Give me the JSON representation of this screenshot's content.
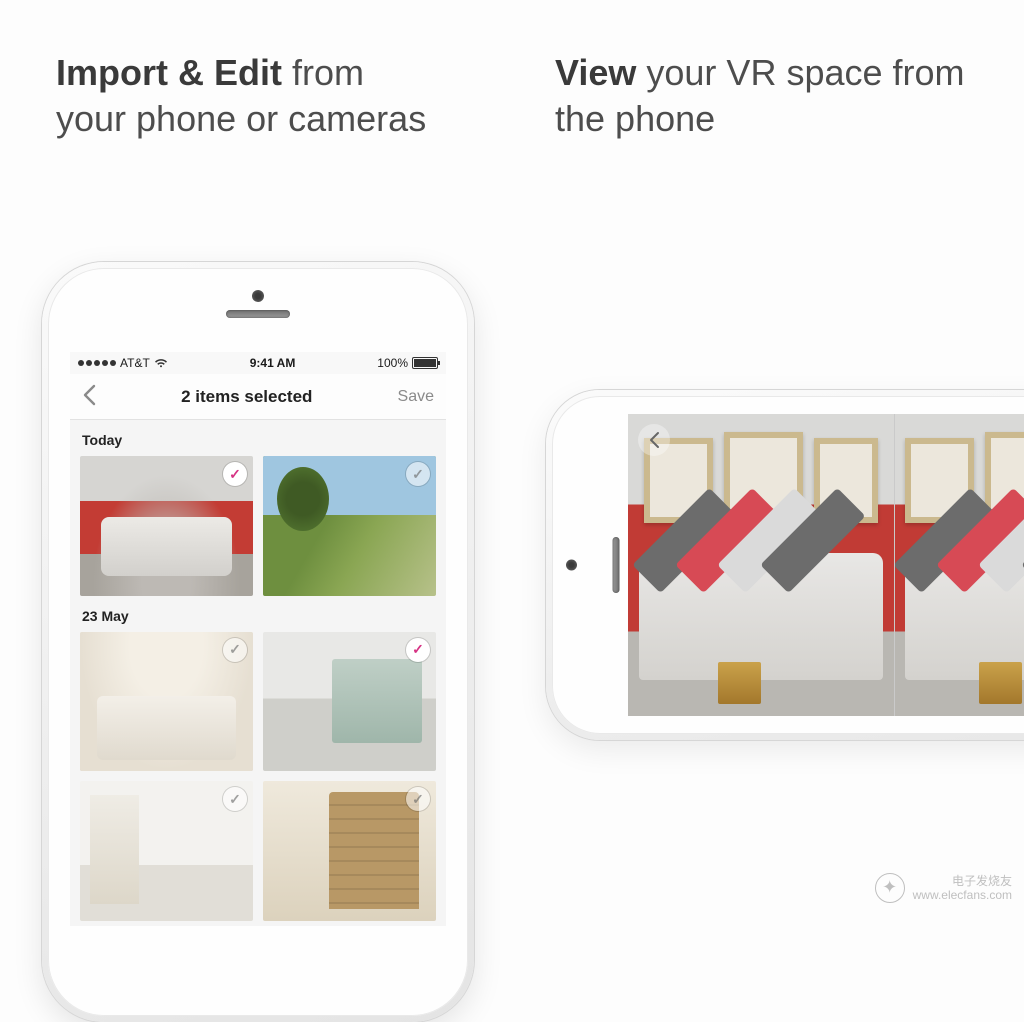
{
  "headings": {
    "left_bold": "Import & Edit",
    "left_rest": " from your phone or cameras",
    "right_bold": "View",
    "right_rest": " your VR space from the phone"
  },
  "statusbar": {
    "carrier": "AT&T",
    "time": "9:41 AM",
    "battery": "100%"
  },
  "navbar": {
    "title": "2 items selected",
    "save": "Save"
  },
  "sections": [
    {
      "title": "Today",
      "items": [
        {
          "name": "living-room-red",
          "selected": true
        },
        {
          "name": "garden-trees",
          "selected": false
        }
      ]
    },
    {
      "title": "23 May",
      "items": [
        {
          "name": "white-lounge",
          "selected": false
        },
        {
          "name": "pool-room",
          "selected": true
        },
        {
          "name": "loft-windows",
          "selected": false
        },
        {
          "name": "bookshelf",
          "selected": false
        }
      ]
    }
  ],
  "watermark": {
    "line1": "电子发烧友",
    "line2": "www.elecfans.com"
  }
}
